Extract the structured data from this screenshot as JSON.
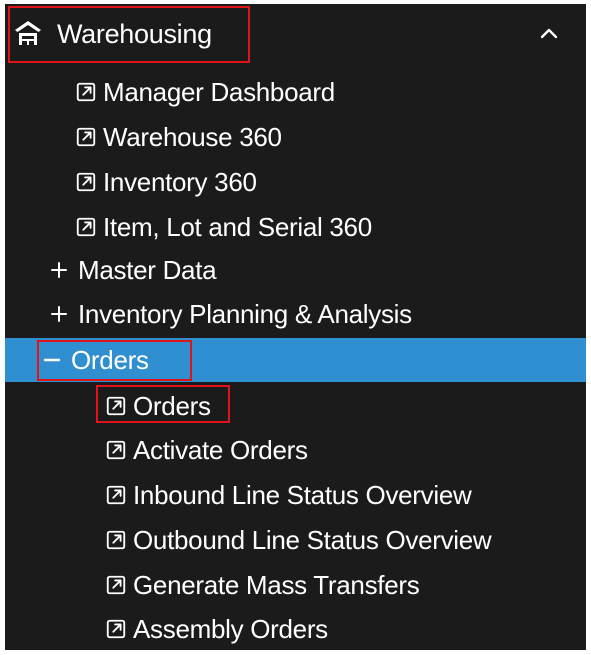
{
  "colors": {
    "menu_background": "#1b1b1b",
    "menu_text": "#ffffff",
    "selected_background": "#2f8fd0",
    "highlight_border": "#e0141b"
  },
  "menu": {
    "header": {
      "icon": "warehouse-icon",
      "label": "Warehousing",
      "collapse_icon": "chevron-up-icon"
    },
    "items": [
      {
        "type": "link",
        "label": "Manager Dashboard",
        "icon": "external-link-icon",
        "level": 1
      },
      {
        "type": "link",
        "label": "Warehouse 360",
        "icon": "external-link-icon",
        "level": 1
      },
      {
        "type": "link",
        "label": "Inventory 360",
        "icon": "external-link-icon",
        "level": 1
      },
      {
        "type": "link",
        "label": "Item, Lot and Serial 360",
        "icon": "external-link-icon",
        "level": 1
      },
      {
        "type": "group",
        "label": "Master Data",
        "icon": "plus-icon",
        "expanded": false,
        "level": 1
      },
      {
        "type": "group",
        "label": "Inventory Planning & Analysis",
        "icon": "plus-icon",
        "expanded": false,
        "level": 1
      },
      {
        "type": "group",
        "label": "Orders",
        "icon": "minus-icon",
        "expanded": true,
        "selected": true,
        "level": 1
      },
      {
        "type": "link",
        "label": "Orders",
        "icon": "external-link-icon",
        "level": 2
      },
      {
        "type": "link",
        "label": "Activate Orders",
        "icon": "external-link-icon",
        "level": 2
      },
      {
        "type": "link",
        "label": "Inbound Line Status Overview",
        "icon": "external-link-icon",
        "level": 2
      },
      {
        "type": "link",
        "label": "Outbound Line Status Overview",
        "icon": "external-link-icon",
        "level": 2
      },
      {
        "type": "link",
        "label": "Generate Mass Transfers",
        "icon": "external-link-icon",
        "level": 2
      },
      {
        "type": "link",
        "label": "Assembly Orders",
        "icon": "external-link-icon",
        "level": 2
      }
    ]
  }
}
